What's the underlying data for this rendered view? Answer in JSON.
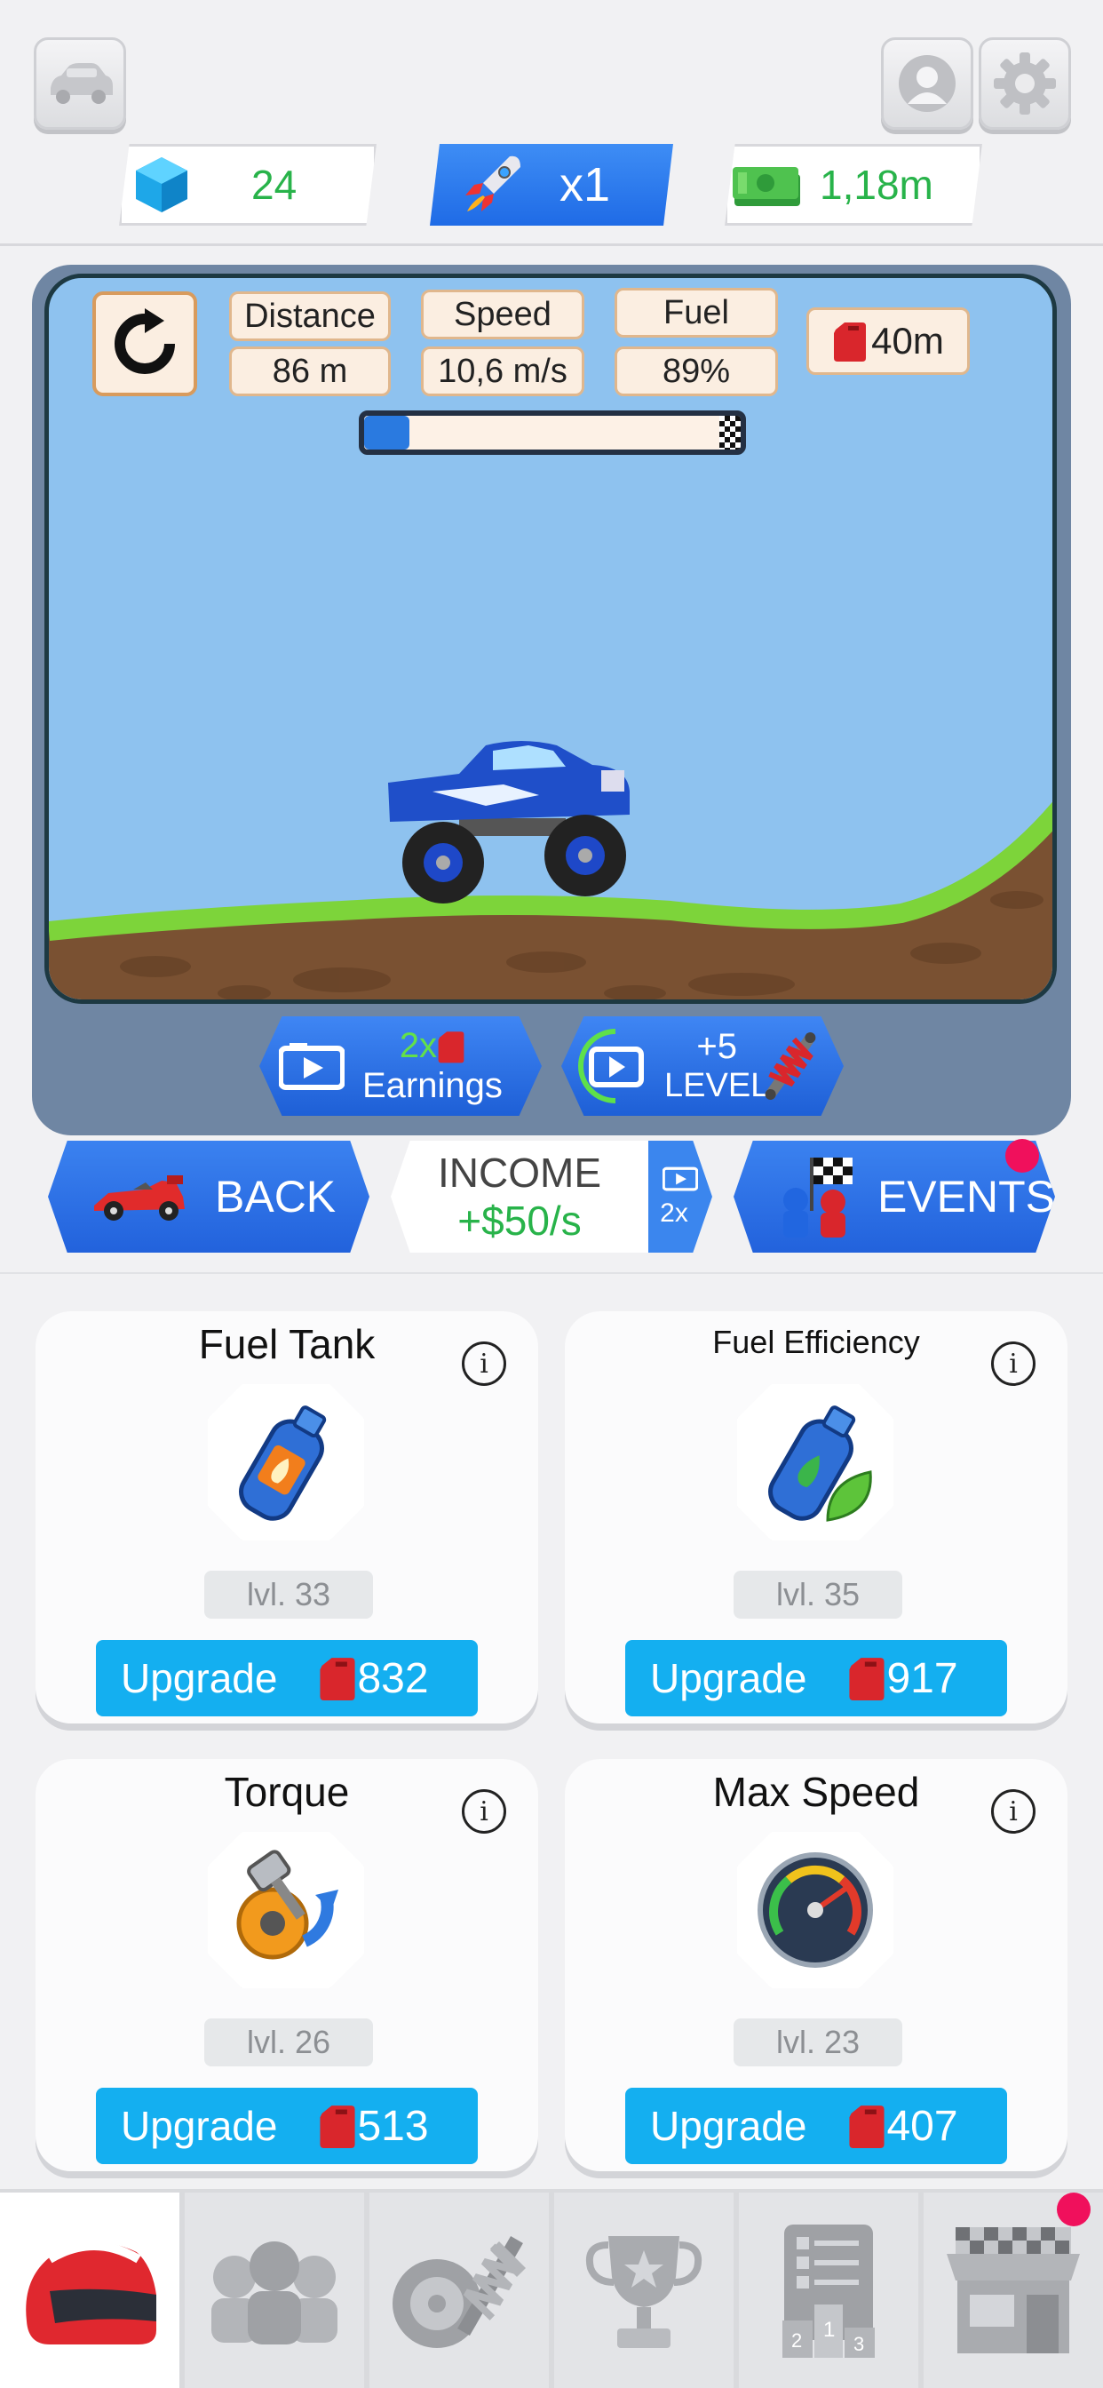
{
  "top": {
    "gems": "24",
    "boost": "x1",
    "cash": "1,18m"
  },
  "hud": {
    "distance_label": "Distance",
    "distance_value": "86 m",
    "speed_label": "Speed",
    "speed_value": "10,6 m/s",
    "fuel_label": "Fuel",
    "fuel_value": "89%",
    "fuel_bonus": "40m",
    "progress": 0.12
  },
  "boosters": {
    "earnings_multiplier": "2x",
    "earnings_label": "Earnings",
    "level_amount": "+5",
    "level_label": "LEVEL"
  },
  "actions": {
    "back": "BACK",
    "income_label": "INCOME",
    "income_value": "+$50/s",
    "income_ad_multiplier": "2x",
    "events": "EVENTS"
  },
  "upgrades": [
    {
      "title": "Fuel Tank",
      "level": "lvl. 33",
      "button": "Upgrade",
      "cost": "832",
      "icon": "fuel-tank-icon"
    },
    {
      "title": "Fuel Efficiency",
      "level": "lvl. 35",
      "button": "Upgrade",
      "cost": "917",
      "icon": "fuel-efficiency-icon"
    },
    {
      "title": "Torque",
      "level": "lvl. 26",
      "button": "Upgrade",
      "cost": "513",
      "icon": "torque-icon"
    },
    {
      "title": "Max Speed",
      "level": "lvl. 23",
      "button": "Upgrade",
      "cost": "407",
      "icon": "speedometer-icon"
    }
  ],
  "nav": [
    "helmet-icon",
    "drivers-icon",
    "parts-icon",
    "trophy-icon",
    "leaderboard-icon",
    "shop-icon"
  ],
  "colors": {
    "accent_blue": "#2262dc",
    "upgrade_blue": "#14aff0",
    "money_green": "#28b34a",
    "notify_pink": "#f0105c"
  }
}
